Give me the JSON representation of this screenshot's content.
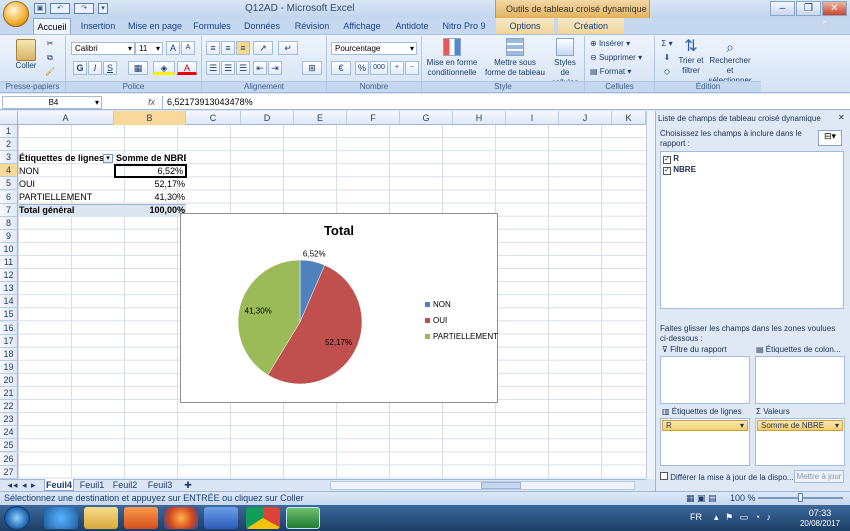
{
  "window": {
    "title": "Q12AD - Microsoft Excel",
    "context_title": "Outils de tableau croisé dynamique"
  },
  "tabs": [
    "Accueil",
    "Insertion",
    "Mise en page",
    "Formules",
    "Données",
    "Révision",
    "Affichage",
    "Antidote",
    "Nitro Pro 9",
    "Options",
    "Création"
  ],
  "ribbon": {
    "clipboard": {
      "paste": "Coller",
      "label": "Presse-papiers"
    },
    "font": {
      "name": "Calibri",
      "size": "11",
      "label": "Police",
      "bold": "G",
      "italic": "I",
      "underline": "S"
    },
    "alignment": {
      "label": "Alignement"
    },
    "number": {
      "format": "Pourcentage",
      "percent": "%",
      "thousands": "000",
      "label": "Nombre"
    },
    "style": {
      "conditional": "Mise en forme conditionnelle",
      "table": "Mettre sous forme de tableau",
      "cell_styles": "Styles de cellules",
      "label": "Style"
    },
    "cells": {
      "insert": "Insérer",
      "delete": "Supprimer",
      "format": "Format",
      "label": "Cellules"
    },
    "editing": {
      "sort": "Trier et filtrer",
      "find": "Rechercher et sélectionner",
      "label": "Édition"
    }
  },
  "formula_bar": {
    "cell_ref": "B4",
    "fx": "fx",
    "value": "6,52173913043478%"
  },
  "columns": [
    "A",
    "B",
    "C",
    "D",
    "E",
    "F",
    "G",
    "H",
    "I",
    "J",
    "K"
  ],
  "rows": [
    "1",
    "2",
    "3",
    "4",
    "5",
    "6",
    "7",
    "8",
    "9",
    "10",
    "11",
    "12",
    "13",
    "14",
    "15",
    "16",
    "17",
    "18",
    "19",
    "20",
    "21",
    "22",
    "23",
    "24",
    "25",
    "26",
    "27"
  ],
  "pivot": {
    "header_labels": "Étiquettes de lignes",
    "header_values": "Somme de NBRE",
    "rows": [
      {
        "label": "NON",
        "value": "6,52%"
      },
      {
        "label": "OUI",
        "value": "52,17%"
      },
      {
        "label": "PARTIELLEMENT",
        "value": "41,30%"
      }
    ],
    "total": {
      "label": "Total général",
      "value": "100,00%"
    }
  },
  "chart_data": {
    "type": "pie",
    "title": "Total",
    "categories": [
      "NON",
      "OUI",
      "PARTIELLEMENT"
    ],
    "values": [
      6.52,
      52.17,
      41.3
    ],
    "data_labels": [
      "6,52%",
      "52,17%",
      "41,30%"
    ],
    "colors": [
      "#4f81bd",
      "#c0504d",
      "#9bbb59"
    ],
    "legend": "right"
  },
  "sheets": [
    "Feuil4",
    "Feuil1",
    "Feuil2",
    "Feuil3"
  ],
  "status": {
    "message": "Sélectionnez une destination et appuyez sur ENTRÉE ou cliquez sur Coller",
    "zoom": "100 %"
  },
  "taskbar": {
    "lang": "FR",
    "time": "07:33",
    "date": "20/08/2017"
  },
  "pane": {
    "title": "Liste de champs de tableau croisé dynamique",
    "instructions": "Choisissez les champs à inclure dans le rapport :",
    "fields": [
      {
        "name": "R",
        "checked": true
      },
      {
        "name": "NBRE",
        "checked": true
      }
    ],
    "drag_text": "Faites glisser les champs dans les zones voulues ci-dessous :",
    "report_filter": "Filtre du rapport",
    "column_labels": "Étiquettes de colon...",
    "row_labels": "Étiquettes de lignes",
    "values": "Valeurs",
    "row_field": "R",
    "value_field": "Somme de NBRE",
    "defer": "Différer la mise à jour de la dispo...",
    "update": "Mettre à jour"
  }
}
